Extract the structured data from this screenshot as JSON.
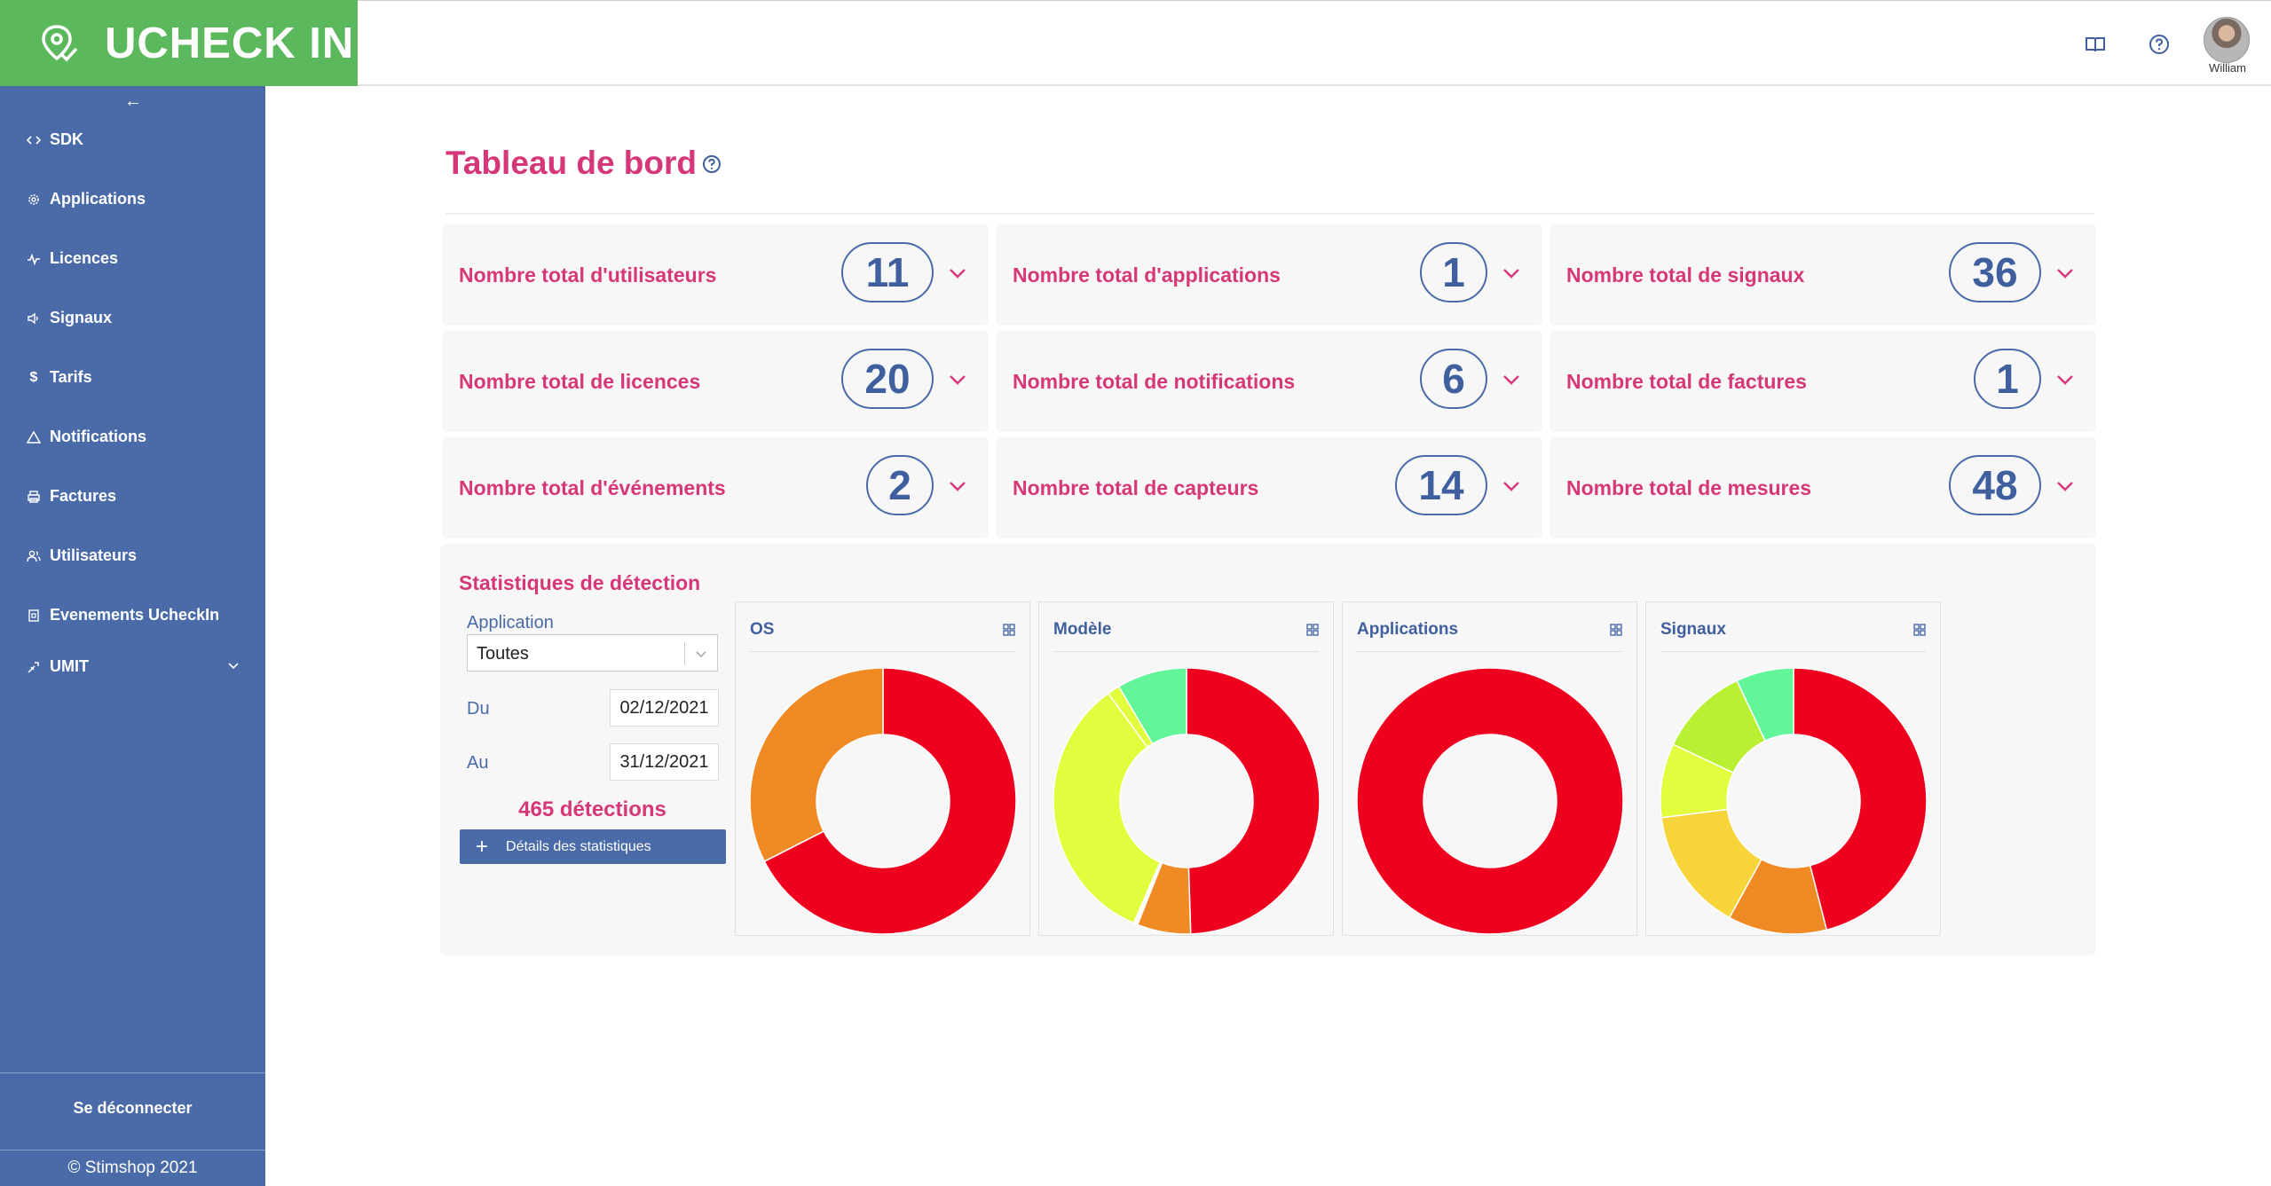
{
  "brand": {
    "name": "UCHECK IN"
  },
  "header": {
    "icons": [
      "book-icon",
      "help-icon",
      "moon-icon",
      "french-flag-icon"
    ],
    "user_name": "William"
  },
  "sidebar": {
    "items": [
      {
        "label": "SDK",
        "icon": "code-icon"
      },
      {
        "label": "Applications",
        "icon": "gear-icon"
      },
      {
        "label": "Licences",
        "icon": "activity-icon"
      },
      {
        "label": "Signaux",
        "icon": "speaker-icon"
      },
      {
        "label": "Tarifs",
        "icon": "dollar-icon"
      },
      {
        "label": "Notifications",
        "icon": "warning-icon"
      },
      {
        "label": "Factures",
        "icon": "printer-icon"
      },
      {
        "label": "Utilisateurs",
        "icon": "users-icon"
      },
      {
        "label": "Evenements UcheckIn",
        "icon": "calendar-icon"
      },
      {
        "label": "UMIT",
        "icon": "umit-icon"
      }
    ],
    "logout": "Se déconnecter",
    "copyright": "© Stimshop 2021"
  },
  "page": {
    "title": "Tableau de bord"
  },
  "cards": [
    {
      "label": "Nombre total d'utilisateurs",
      "value": "11"
    },
    {
      "label": "Nombre total d'applications",
      "value": "1"
    },
    {
      "label": "Nombre total de signaux",
      "value": "36"
    },
    {
      "label": "Nombre total de licences",
      "value": "20"
    },
    {
      "label": "Nombre total de notifications",
      "value": "6"
    },
    {
      "label": "Nombre total de factures",
      "value": "1"
    },
    {
      "label": "Nombre total d'événements",
      "value": "2"
    },
    {
      "label": "Nombre total de capteurs",
      "value": "14"
    },
    {
      "label": "Nombre total de mesures",
      "value": "48"
    }
  ],
  "stats": {
    "title": "Statistiques de détection",
    "application_label": "Application",
    "application_value": "Toutes",
    "from_label": "Du",
    "from_value": "02/12/2021",
    "to_label": "Au",
    "to_value": "31/12/2021",
    "detections": "465 détections",
    "details_button": "Détails des statistiques"
  },
  "colors": {
    "brand_green": "#5cb85c",
    "sidebar_blue": "#4a6aa8",
    "accent_pink": "#d63779",
    "red": "#f0001f",
    "orange": "#f08a24",
    "lime": "#e2fc3e",
    "yellow_green": "#b9f034",
    "yellow": "#f6d43a",
    "light_green": "#62f59a"
  },
  "chart_data": [
    {
      "type": "pie",
      "title": "OS",
      "values": [
        67.5,
        32.5
      ],
      "colors": [
        "#f0001f",
        "#f08a24"
      ]
    },
    {
      "type": "pie",
      "title": "Modèle",
      "values": [
        49.5,
        6.5,
        0.5,
        33.5,
        1.5,
        8.5
      ],
      "colors": [
        "#f0001f",
        "#f08a24",
        "#ffffff",
        "#e2fc3e",
        "#e2fc3e",
        "#62f59a"
      ]
    },
    {
      "type": "pie",
      "title": "Applications",
      "values": [
        100
      ],
      "colors": [
        "#f0001f"
      ]
    },
    {
      "type": "pie",
      "title": "Signaux",
      "values": [
        46,
        12,
        15,
        9,
        11,
        7
      ],
      "colors": [
        "#f0001f",
        "#f08a24",
        "#f6d43a",
        "#e2fc3e",
        "#b9f034",
        "#62f59a"
      ]
    }
  ]
}
